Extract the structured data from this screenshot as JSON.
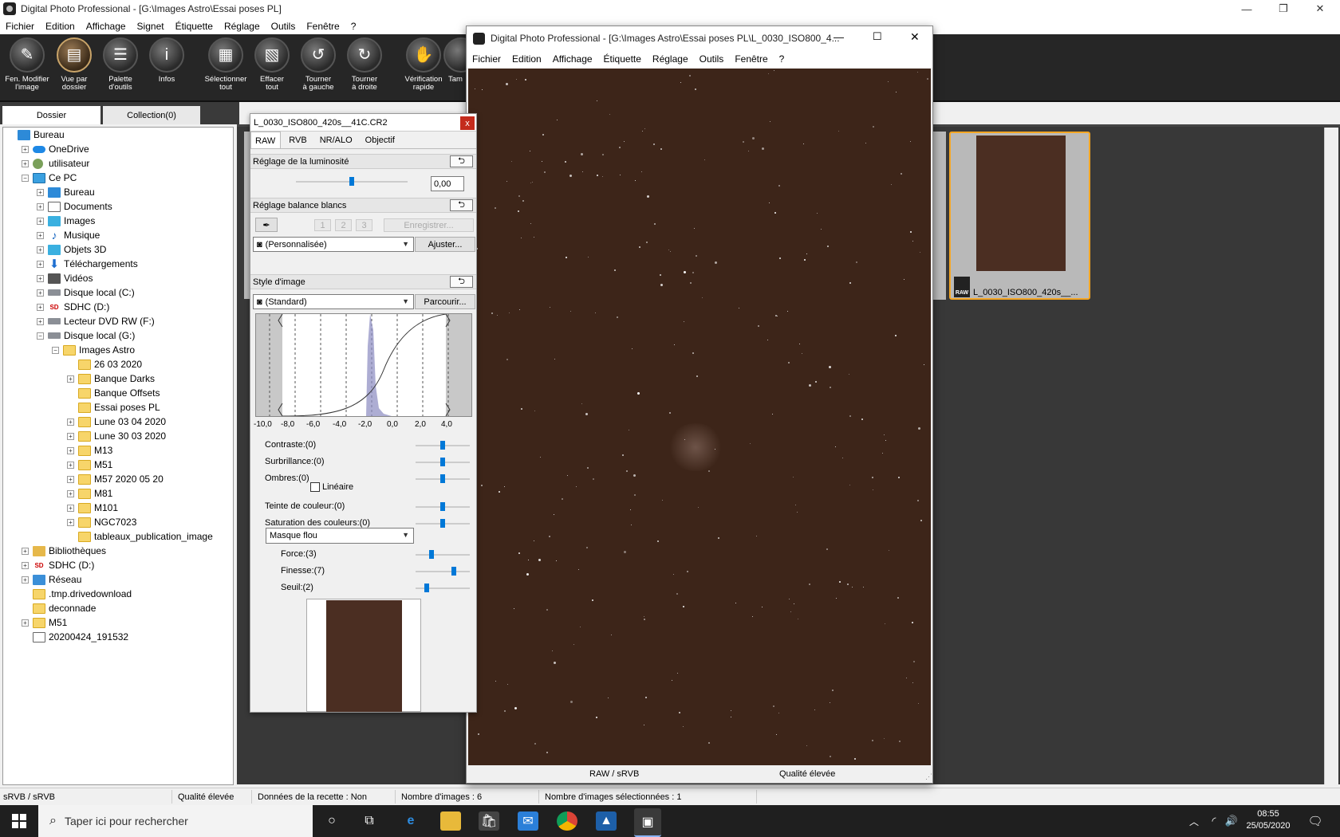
{
  "main_window": {
    "title": "Digital Photo Professional - [G:\\Images Astro\\Essai poses PL]",
    "controls": {
      "minimize": "—",
      "maximize": "❐",
      "close": "✕"
    },
    "menu": [
      "Fichier",
      "Edition",
      "Affichage",
      "Signet",
      "Étiquette",
      "Réglage",
      "Outils",
      "Fenêtre",
      "?"
    ]
  },
  "toolbar": {
    "buttons": [
      {
        "label1": "Fen. Modifier",
        "label2": "l'image",
        "icon": "edit-image-icon"
      },
      {
        "label1": "Vue par",
        "label2": "dossier",
        "icon": "folder-view-icon"
      },
      {
        "label1": "Palette",
        "label2": "d'outils",
        "icon": "tool-palette-icon"
      },
      {
        "label1": "Infos",
        "label2": "",
        "icon": "info-icon"
      },
      {
        "label1": "Sélectionner",
        "label2": "tout",
        "icon": "select-all-icon"
      },
      {
        "label1": "Effacer",
        "label2": "tout",
        "icon": "clear-all-icon"
      },
      {
        "label1": "Tourner",
        "label2": "à gauche",
        "icon": "rotate-left-icon"
      },
      {
        "label1": "Tourner",
        "label2": "à droite",
        "icon": "rotate-right-icon"
      },
      {
        "label1": "Vérification",
        "label2": "rapide",
        "icon": "quick-check-icon"
      },
      {
        "label1": "Tam",
        "label2": "",
        "icon": "stamp-icon"
      }
    ]
  },
  "folder_tabs": {
    "dossier": "Dossier",
    "collection": "Collection(0)"
  },
  "tree": [
    {
      "label": "Bureau",
      "depth": 0,
      "exp": "",
      "icon": "blue"
    },
    {
      "label": "OneDrive",
      "depth": 1,
      "exp": "+",
      "icon": "cloud"
    },
    {
      "label": "utilisateur",
      "depth": 1,
      "exp": "+",
      "icon": "user"
    },
    {
      "label": "Ce PC",
      "depth": 1,
      "exp": "−",
      "icon": "pc"
    },
    {
      "label": "Bureau",
      "depth": 2,
      "exp": "+",
      "icon": "blue"
    },
    {
      "label": "Documents",
      "depth": 2,
      "exp": "+",
      "icon": "doc"
    },
    {
      "label": "Images",
      "depth": 2,
      "exp": "+",
      "icon": "box"
    },
    {
      "label": "Musique",
      "depth": 2,
      "exp": "+",
      "icon": "music"
    },
    {
      "label": "Objets 3D",
      "depth": 2,
      "exp": "+",
      "icon": "box"
    },
    {
      "label": "Téléchargements",
      "depth": 2,
      "exp": "+",
      "icon": "dl"
    },
    {
      "label": "Vidéos",
      "depth": 2,
      "exp": "+",
      "icon": "film"
    },
    {
      "label": "Disque local (C:)",
      "depth": 2,
      "exp": "+",
      "icon": "drive"
    },
    {
      "label": "SDHC (D:)",
      "depth": 2,
      "exp": "+",
      "icon": "sd"
    },
    {
      "label": "Lecteur DVD RW (F:)",
      "depth": 2,
      "exp": "+",
      "icon": "drive"
    },
    {
      "label": "Disque local (G:)",
      "depth": 2,
      "exp": "−",
      "icon": "drive"
    },
    {
      "label": "Images Astro",
      "depth": 3,
      "exp": "−",
      "icon": "folder"
    },
    {
      "label": "26 03 2020",
      "depth": 4,
      "exp": "",
      "icon": "folder"
    },
    {
      "label": "Banque Darks",
      "depth": 4,
      "exp": "+",
      "icon": "folder"
    },
    {
      "label": "Banque Offsets",
      "depth": 4,
      "exp": "",
      "icon": "folder"
    },
    {
      "label": "Essai poses PL",
      "depth": 4,
      "exp": "",
      "icon": "folder"
    },
    {
      "label": "Lune 03 04 2020",
      "depth": 4,
      "exp": "+",
      "icon": "folder"
    },
    {
      "label": "Lune 30 03 2020",
      "depth": 4,
      "exp": "+",
      "icon": "folder"
    },
    {
      "label": "M13",
      "depth": 4,
      "exp": "+",
      "icon": "folder"
    },
    {
      "label": "M51",
      "depth": 4,
      "exp": "+",
      "icon": "folder"
    },
    {
      "label": "M57 2020 05 20",
      "depth": 4,
      "exp": "+",
      "icon": "folder"
    },
    {
      "label": "M81",
      "depth": 4,
      "exp": "+",
      "icon": "folder"
    },
    {
      "label": "M101",
      "depth": 4,
      "exp": "+",
      "icon": "folder"
    },
    {
      "label": "NGC7023",
      "depth": 4,
      "exp": "+",
      "icon": "folder"
    },
    {
      "label": "tableaux_publication_image",
      "depth": 4,
      "exp": "",
      "icon": "folder"
    },
    {
      "label": "Bibliothèques",
      "depth": 1,
      "exp": "+",
      "icon": "lib"
    },
    {
      "label": "SDHC (D:)",
      "depth": 1,
      "exp": "+",
      "icon": "sd"
    },
    {
      "label": "Réseau",
      "depth": 1,
      "exp": "+",
      "icon": "net"
    },
    {
      "label": ".tmp.drivedownload",
      "depth": 1,
      "exp": "",
      "icon": "folder"
    },
    {
      "label": "deconnade",
      "depth": 1,
      "exp": "",
      "icon": "folder"
    },
    {
      "label": "M51",
      "depth": 1,
      "exp": "+",
      "icon": "folder"
    },
    {
      "label": "20200424_191532",
      "depth": 1,
      "exp": "",
      "icon": "doc"
    }
  ],
  "thumbnail": {
    "raw_badge": "RAW",
    "label": "L_0030_ISO800_420s__..."
  },
  "palette": {
    "title": "L_0030_ISO800_420s__41C.CR2",
    "close": "x",
    "tabs": [
      "RAW",
      "RVB",
      "NR/ALO",
      "Objectif"
    ],
    "brightness": {
      "header": "Réglage de la luminosité",
      "value": "0,00",
      "reset": "⮌"
    },
    "wb": {
      "header": "Réglage balance blancs",
      "reset": "⮌",
      "presets": [
        "1",
        "2",
        "3"
      ],
      "register": "Enregistrer...",
      "mode": "(Personnalisée)",
      "adjust": "Ajuster..."
    },
    "style": {
      "header": "Style d'image",
      "reset": "⮌",
      "value": "(Standard)",
      "browse": "Parcourir..."
    },
    "histogram_axis": [
      "-10,0",
      "-8,0",
      "-6,0",
      "-4,0",
      "-2,0",
      "0,0",
      "2,0",
      "4,0"
    ],
    "sliders": [
      {
        "label": "Contraste:(0)",
        "level": 0.5
      },
      {
        "label": "Surbrillance:(0)",
        "level": 0.5
      },
      {
        "label": "Ombres:(0)",
        "level": 0.5
      },
      {
        "label": "Teinte de couleur:(0)",
        "level": 0.5
      },
      {
        "label": "Saturation des couleurs:(0)",
        "level": 0.5
      }
    ],
    "linear": "Linéaire",
    "sharpen_mode": "Masque flou",
    "sharpen": [
      {
        "label": "Force:(3)",
        "level": 0.3
      },
      {
        "label": "Finesse:(7)",
        "level": 0.7
      },
      {
        "label": "Seuil:(2)",
        "level": 0.2
      }
    ]
  },
  "image_window": {
    "title": "Digital Photo Professional - [G:\\Images Astro\\Essai poses PL\\L_0030_ISO800_4...",
    "menu": [
      "Fichier",
      "Edition",
      "Affichage",
      "Étiquette",
      "Réglage",
      "Outils",
      "Fenêtre",
      "?"
    ],
    "status_color": "RAW / sRVB",
    "status_quality": "Qualité élevée"
  },
  "status_bar": {
    "color_space": "sRVB / sRVB",
    "quality": "Qualité élevée",
    "recipe": "Données de la recette : Non",
    "count": "Nombre d'images : 6",
    "selected": "Nombre d'images sélectionnées : 1"
  },
  "taskbar": {
    "search_placeholder": "Taper ici pour rechercher",
    "time": "08:55",
    "date": "25/05/2020"
  },
  "colors": {
    "accent": "#f5a623",
    "toolbar_bg": "#262626",
    "sky": "#3d2519",
    "slider": "#0078d7"
  }
}
